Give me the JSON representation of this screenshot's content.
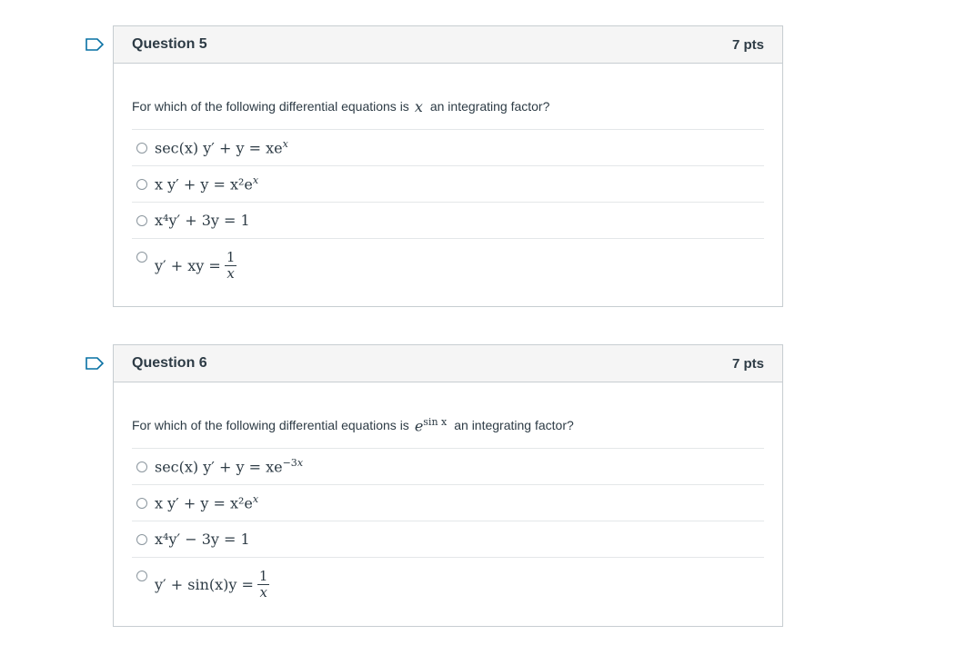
{
  "questions": [
    {
      "title": "Question 5",
      "points": "7 pts",
      "prompt_before": "For which of the following differential equations is",
      "prompt_math": "x",
      "prompt_after": "an integrating factor?",
      "answers": [
        "sec(x)  y′ + y = xe",
        "x  y′ + y = x²e",
        "x⁴y′ + 3y = 1",
        "y′ + xy ="
      ]
    },
    {
      "title": "Question 6",
      "points": "7 pts",
      "prompt_before": "For which of the following differential equations is",
      "prompt_math": "e",
      "prompt_math_sup": "sin x",
      "prompt_after": "an integrating factor?",
      "answers": [
        "sec(x)  y′ + y = xe",
        "x  y′ + y = x²e",
        "x⁴y′ − 3y = 1",
        "y′ + sin(x)y ="
      ]
    }
  ]
}
